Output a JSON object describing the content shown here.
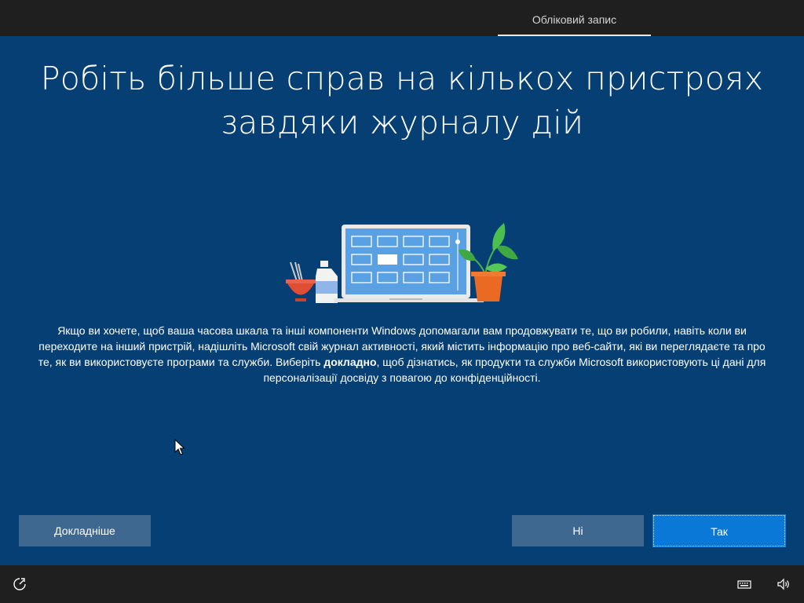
{
  "header": {
    "tabs": [
      {
        "label": "Обліковий запис",
        "active": true
      }
    ]
  },
  "main": {
    "title_line1": "Робіть більше справ на кількох пристроях",
    "title_line2": "завдяки журналу дій",
    "illustration_icon": "laptop-plant-bottle-bowl-illustration",
    "description": {
      "part1": "Якщо ви хочете, щоб ваша часова шкала та інші компоненти Windows допомагали вам продовжувати те, що ви робили, навіть коли ви переходите на інший пристрій, надішліть Microsoft свій журнал активності, який містить інформацію про веб-сайти, які ви переглядаєте та про те, як ви використовуєте програми та служби. Виберіть ",
      "bold": "докладно",
      "part2": ", щоб дізнатись, як продукти та служби Microsoft використовують ці дані для персоналізації досвіду з повагою до конфіденційності."
    },
    "buttons": {
      "learn_more": "Докладніше",
      "no": "Ні",
      "yes": "Так"
    }
  },
  "footer": {
    "left_icon": "accessibility-icon",
    "right_icons": [
      "keyboard-icon",
      "volume-icon"
    ]
  },
  "colors": {
    "background": "#063f74",
    "bar": "#1f1f1f",
    "primary_button": "#0a78d7",
    "secondary_button": "#3f6891"
  }
}
